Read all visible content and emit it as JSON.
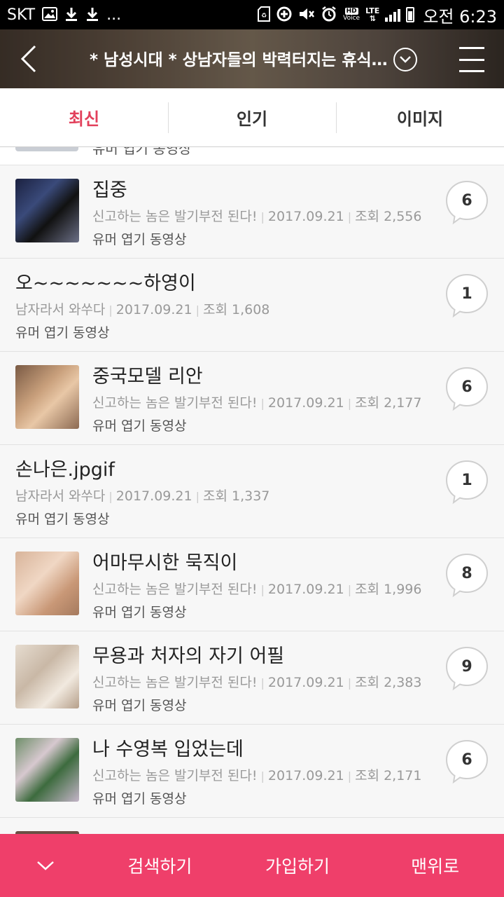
{
  "status_bar": {
    "carrier": "SKT",
    "left_icons": [
      "image-icon",
      "download-icon",
      "download-icon",
      "more-icon"
    ],
    "right_icons": [
      "sd-card-icon",
      "data-saver-icon",
      "mute-icon",
      "alarm-icon",
      "hd-voice-icon",
      "lte-icon",
      "signal-icon",
      "battery-icon"
    ],
    "hd_label": "HD",
    "voice_label": "Voice",
    "lte_label": "LTE",
    "more_dots": "...",
    "time": "오전 6:23"
  },
  "header": {
    "title": "* 남성시대 * 상남자들의 박력터지는 휴식…"
  },
  "tabs": [
    {
      "label": "최신",
      "active": true
    },
    {
      "label": "인기",
      "active": false
    },
    {
      "label": "이미지",
      "active": false
    }
  ],
  "peek_text": "유머 엽기 동영상",
  "posts": [
    {
      "title": "집중",
      "author": "신고하는 놈은 발기부전 된다!",
      "date": "2017.09.21",
      "views": "조회 2,556",
      "category": "유머 엽기 동영상",
      "comments": "6",
      "thumb": "thumb-dark"
    },
    {
      "title": "오~~~~~~~하영이",
      "author": "남자라서 와쑤다",
      "date": "2017.09.21",
      "views": "조회 1,608",
      "category": "유머 엽기 동영상",
      "comments": "1",
      "thumb": null
    },
    {
      "title": "중국모델 리안",
      "author": "신고하는 놈은 발기부전 된다!",
      "date": "2017.09.21",
      "views": "조회 2,177",
      "category": "유머 엽기 동영상",
      "comments": "6",
      "thumb": "thumb-warm"
    },
    {
      "title": "손나은.jpgif",
      "author": "남자라서 와쑤다",
      "date": "2017.09.21",
      "views": "조회 1,337",
      "category": "유머 엽기 동영상",
      "comments": "1",
      "thumb": null
    },
    {
      "title": "어마무시한 묵직이",
      "author": "신고하는 놈은 발기부전 된다!",
      "date": "2017.09.21",
      "views": "조회 1,996",
      "category": "유머 엽기 동영상",
      "comments": "8",
      "thumb": "thumb-skin"
    },
    {
      "title": "무용과 처자의 자기 어필",
      "author": "신고하는 놈은 발기부전 된다!",
      "date": "2017.09.21",
      "views": "조회 2,383",
      "category": "유머 엽기 동영상",
      "comments": "9",
      "thumb": "thumb-light"
    },
    {
      "title": "나 수영복 입었는데",
      "author": "신고하는 놈은 발기부전 된다!",
      "date": "2017.09.21",
      "views": "조회 2,171",
      "category": "유머 엽기 동영상",
      "comments": "6",
      "thumb": "thumb-floral"
    }
  ],
  "bottom_bar": {
    "search_label": "검색하기",
    "join_label": "가입하기",
    "top_label": "맨위로"
  },
  "colors": {
    "accent": "#e2405b",
    "bottom_bar": "#ef3f6a",
    "meta_text": "#999999"
  }
}
